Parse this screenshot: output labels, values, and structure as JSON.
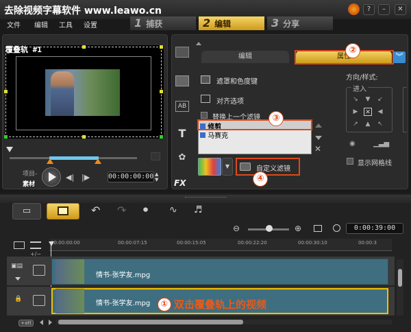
{
  "app": {
    "title": "去除视频字幕软件 www.leawo.cn"
  },
  "menu": [
    "文件",
    "编辑",
    "工具",
    "设置"
  ],
  "steps": [
    {
      "num": "1",
      "label": "捕获"
    },
    {
      "num": "2",
      "label": "编辑"
    },
    {
      "num": "3",
      "label": "分享"
    }
  ],
  "preview": {
    "overlay_label": "覆叠轨 #1",
    "mode_project": "项目-",
    "mode_clip": "素材",
    "timecode": "00:00:00:00"
  },
  "options": {
    "tabs": [
      "编辑",
      "属性"
    ],
    "mask_label": "遮罩和色度键",
    "align_label": "对齐选项",
    "replace_filter_label": "替换上一个滤镜",
    "filters": [
      "修剪",
      "马赛克"
    ],
    "custom_filter_label": "自定义滤镜",
    "direction_label": "方向/样式:",
    "enter_label": "进入",
    "grid_label": "显示网格线"
  },
  "timeline": {
    "timecode": "0:00:39:00",
    "ruler": [
      "00:00:00:00",
      "00:00:07:15",
      "00:00:15:05",
      "00:00:22:20",
      "00:00:30:10",
      "00:00:3"
    ],
    "clip_video": "情书-张学友.mpg",
    "clip_overlay": "情书-张学友.mpg"
  },
  "annotations": {
    "n1": "①",
    "n2": "②",
    "n3": "③",
    "n4": "④",
    "instruction": "双击覆叠轨上的视频"
  },
  "colors": {
    "accent": "#e04818",
    "active_tab": "#e8b83a",
    "clip": "#3f6e80"
  }
}
